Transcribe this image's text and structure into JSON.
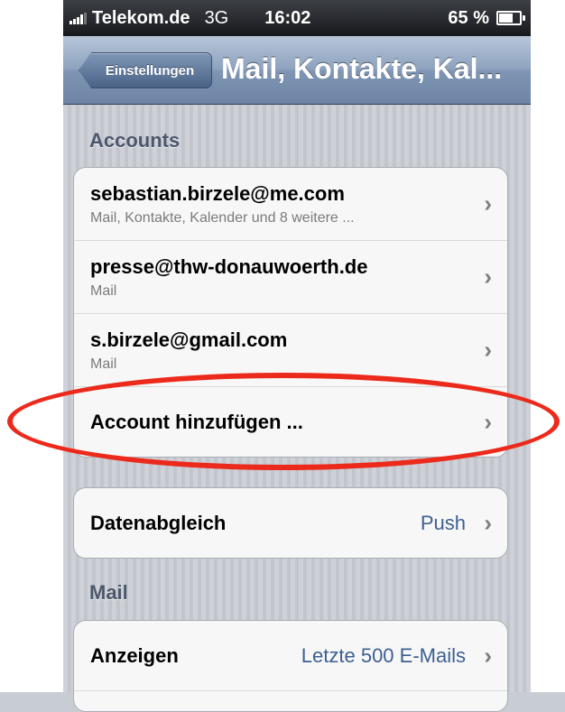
{
  "status_bar": {
    "carrier": "Telekom.de",
    "network": "3G",
    "time": "16:02",
    "battery": "65 %",
    "battery_level": 0.65
  },
  "nav": {
    "back_label": "Einstellungen",
    "title": "Mail, Kontakte, Kal..."
  },
  "accounts": {
    "header": "Accounts",
    "items": [
      {
        "title": "sebastian.birzele@me.com",
        "subtitle": "Mail, Kontakte, Kalender und 8 weitere ..."
      },
      {
        "title": "presse@thw-donauwoerth.de",
        "subtitle": "Mail"
      },
      {
        "title": "s.birzele@gmail.com",
        "subtitle": "Mail"
      }
    ],
    "add_label": "Account hinzufügen ..."
  },
  "fetch": {
    "label": "Datenabgleich",
    "value": "Push"
  },
  "mail": {
    "header": "Mail",
    "show_label": "Anzeigen",
    "show_value": "Letzte 500 E-Mails"
  },
  "colors": {
    "annotation": "#ec2a1b",
    "value_blue": "#3d5f92"
  },
  "icons": {
    "chevron": "chevron-right-icon",
    "signal": "signal-bars-icon",
    "battery": "battery-icon"
  }
}
